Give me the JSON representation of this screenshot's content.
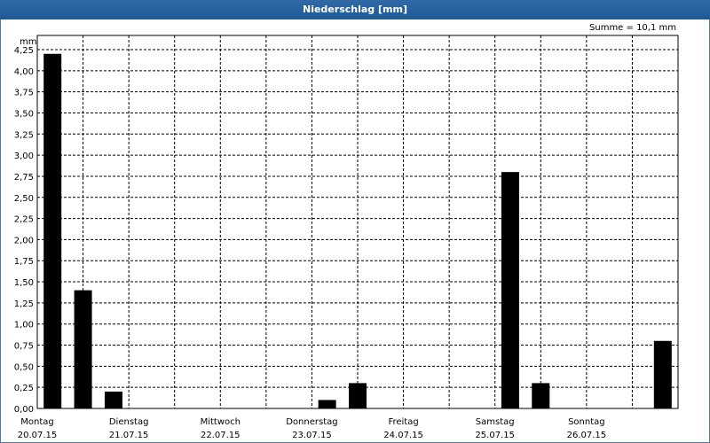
{
  "window": {
    "title": "Niederschlag [mm]"
  },
  "summary": {
    "text": "Summe = 10,1 mm"
  },
  "chart_data": {
    "type": "bar",
    "title": "Niederschlag [mm]",
    "ylabel": "mm",
    "ylim": [
      0,
      4.25
    ],
    "grid": true,
    "y_ticks": [
      "0,00",
      "0,25",
      "0,50",
      "0,75",
      "1,00",
      "1,25",
      "1,50",
      "1,75",
      "2,00",
      "2,25",
      "2,50",
      "2,75",
      "3,00",
      "3,25",
      "3,50",
      "3,75",
      "4,00",
      "4,25"
    ],
    "x_labels": [
      {
        "day": "Montag",
        "date": "20.07.15"
      },
      {
        "day": "Dienstag",
        "date": "21.07.15"
      },
      {
        "day": "Mittwoch",
        "date": "22.07.15"
      },
      {
        "day": "Donnerstag",
        "date": "23.07.15"
      },
      {
        "day": "Freitag",
        "date": "24.07.15"
      },
      {
        "day": "Samstag",
        "date": "25.07.15"
      },
      {
        "day": "Sonntag",
        "date": "26.07.15"
      }
    ],
    "bars_per_day": 3,
    "values": [
      4.2,
      1.4,
      0.2,
      0,
      0,
      0,
      0,
      0,
      0,
      0.1,
      0.3,
      0,
      0,
      0,
      0,
      2.8,
      0.3,
      0,
      0,
      0,
      0.8
    ]
  }
}
